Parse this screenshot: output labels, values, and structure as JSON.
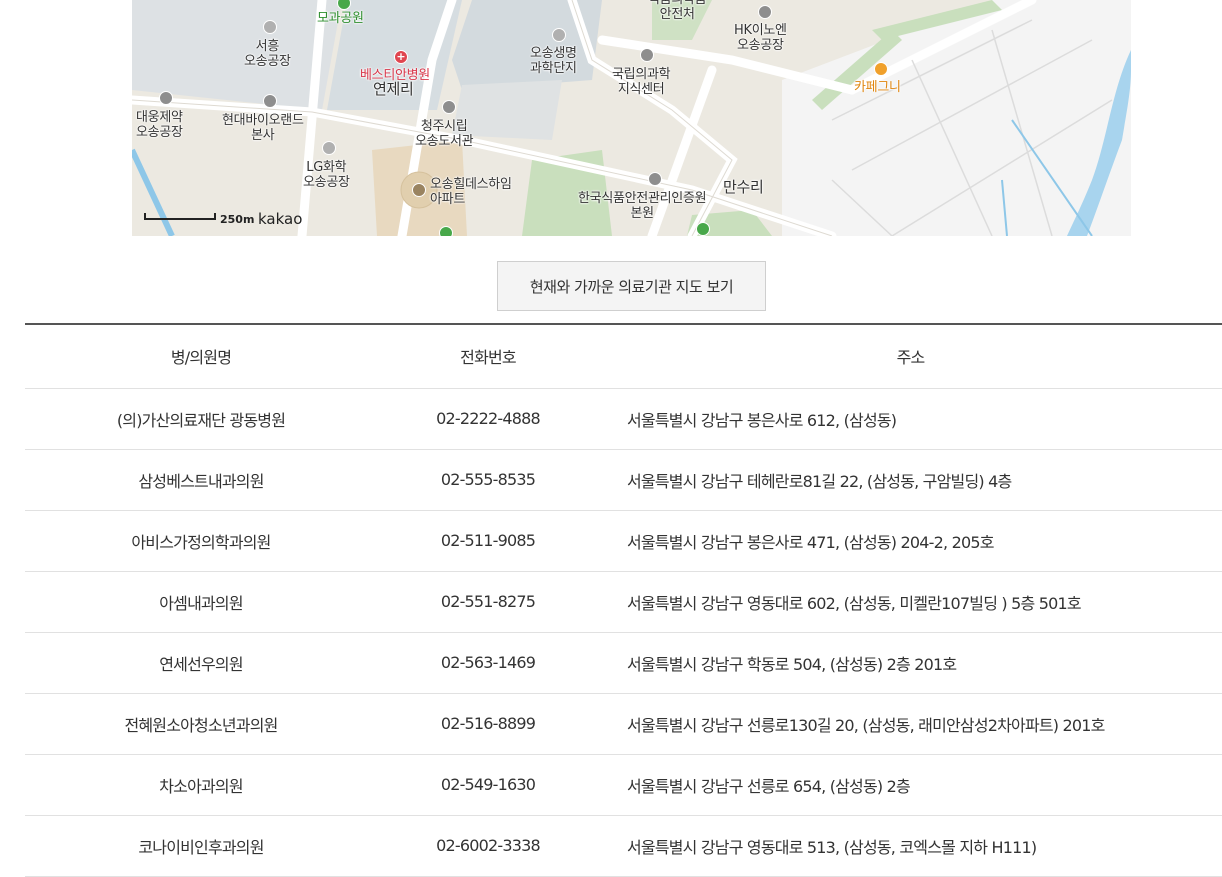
{
  "map": {
    "labels": {
      "mogwa_park": "모과공원",
      "seoheung": "서흥\n오송공장",
      "bestian": "베스티안병원",
      "yeonje": "연제리",
      "osong_bio": "오송생명\n과학단지",
      "national_lib": "국립의과학\n지식센터",
      "food_drug": "식품의약품\n안전처",
      "hk_innoen": "HK이노엔\n오송공장",
      "cafe": "카페그니",
      "daewoong": "대웅제약\n오송공장",
      "hyundai_bio": "현대바이오랜드\n본사",
      "cheongju_lib": "청주시립\n오송도서관",
      "lg_chem": "LG화학\n오송공장",
      "hillstate": "오송힐데스하임\n아파트",
      "food_safety": "한국식품안전관리인증원\n본원",
      "mansuri": "만수리"
    },
    "scale_label": "250m",
    "brand": "kakao"
  },
  "button": {
    "label": "현재와 가까운 의료기관 지도 보기"
  },
  "table": {
    "headers": [
      "병/의원명",
      "전화번호",
      "주소"
    ],
    "rows": [
      {
        "name": "(의)가산의료재단 광동병원",
        "phone": "02-2222-4888",
        "address": "서울특별시 강남구 봉은사로 612, (삼성동)"
      },
      {
        "name": "삼성베스트내과의원",
        "phone": "02-555-8535",
        "address": "서울특별시 강남구 테헤란로81길 22, (삼성동, 구암빌딩) 4층"
      },
      {
        "name": "아비스가정의학과의원",
        "phone": "02-511-9085",
        "address": "서울특별시 강남구 봉은사로 471, (삼성동) 204-2, 205호"
      },
      {
        "name": "아셈내과의원",
        "phone": "02-551-8275",
        "address": "서울특별시 강남구 영동대로 602, (삼성동, 미켈란107빌딩 ) 5층 501호"
      },
      {
        "name": "연세선우의원",
        "phone": "02-563-1469",
        "address": "서울특별시 강남구 학동로 504, (삼성동) 2층 201호"
      },
      {
        "name": "전혜원소아청소년과의원",
        "phone": "02-516-8899",
        "address": "서울특별시 강남구 선릉로130길 20, (삼성동, 래미안삼성2차아파트) 201호"
      },
      {
        "name": "차소아과의원",
        "phone": "02-549-1630",
        "address": "서울특별시 강남구 선릉로 654, (삼성동) 2층"
      },
      {
        "name": "코나이비인후과의원",
        "phone": "02-6002-3338",
        "address": "서울특별시 강남구 영동대로 513, (삼성동, 코엑스몰 지하 H111)"
      }
    ]
  }
}
